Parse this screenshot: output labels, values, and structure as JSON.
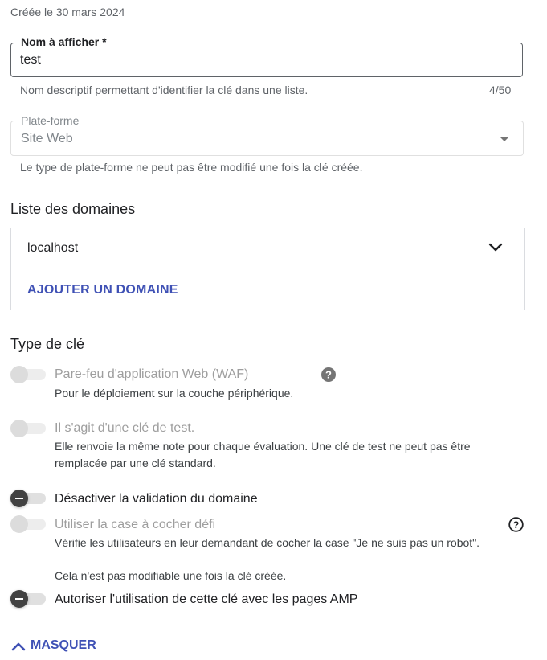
{
  "created_label": "Créée le 30 mars 2024",
  "display_name": {
    "label": "Nom à afficher *",
    "value": "test",
    "helper": "Nom descriptif permettant d'identifier la clé dans une liste.",
    "counter": "4/50"
  },
  "platform": {
    "label": "Plate-forme",
    "value": "Site Web",
    "helper": "Le type de plate-forme ne peut pas être modifié une fois la clé créée."
  },
  "domains": {
    "title": "Liste des domaines",
    "items": [
      "localhost"
    ],
    "add_label": "AJOUTER UN DOMAINE"
  },
  "key_type": {
    "title": "Type de clé",
    "options": [
      {
        "title": "Pare-feu d'application Web (WAF)",
        "desc": "Pour le déploiement sur la couche périphérique.",
        "enabled": false,
        "checked": false
      },
      {
        "title": "Il s'agit d'une clé de test.",
        "desc": "Elle renvoie la même note pour chaque évaluation. Une clé de test ne peut pas être remplacée par une clé standard.",
        "enabled": false,
        "checked": false
      },
      {
        "title": "Désactiver la validation du domaine",
        "enabled": true,
        "checked": false
      },
      {
        "title": "Utiliser la case à cocher défi",
        "desc": "Vérifie les utilisateurs en leur demandant de cocher la case \"Je ne suis pas un robot\".",
        "desc2": "Cela n'est pas modifiable une fois la clé créée.",
        "enabled": false,
        "checked": false
      },
      {
        "title": "Autoriser l'utilisation de cette clé avec les pages AMP",
        "enabled": true,
        "checked": false
      }
    ]
  },
  "hide_label": "MASQUER",
  "colors": {
    "accent": "#3f51b5",
    "text": "#202124",
    "muted": "#5f6368",
    "disabled": "#9e9e9e"
  },
  "icons": {
    "help": "help-circle-icon",
    "chevron": "chevron-down-icon",
    "collapse": "chevron-up-icon",
    "dropdown": "dropdown-arrow-icon"
  }
}
